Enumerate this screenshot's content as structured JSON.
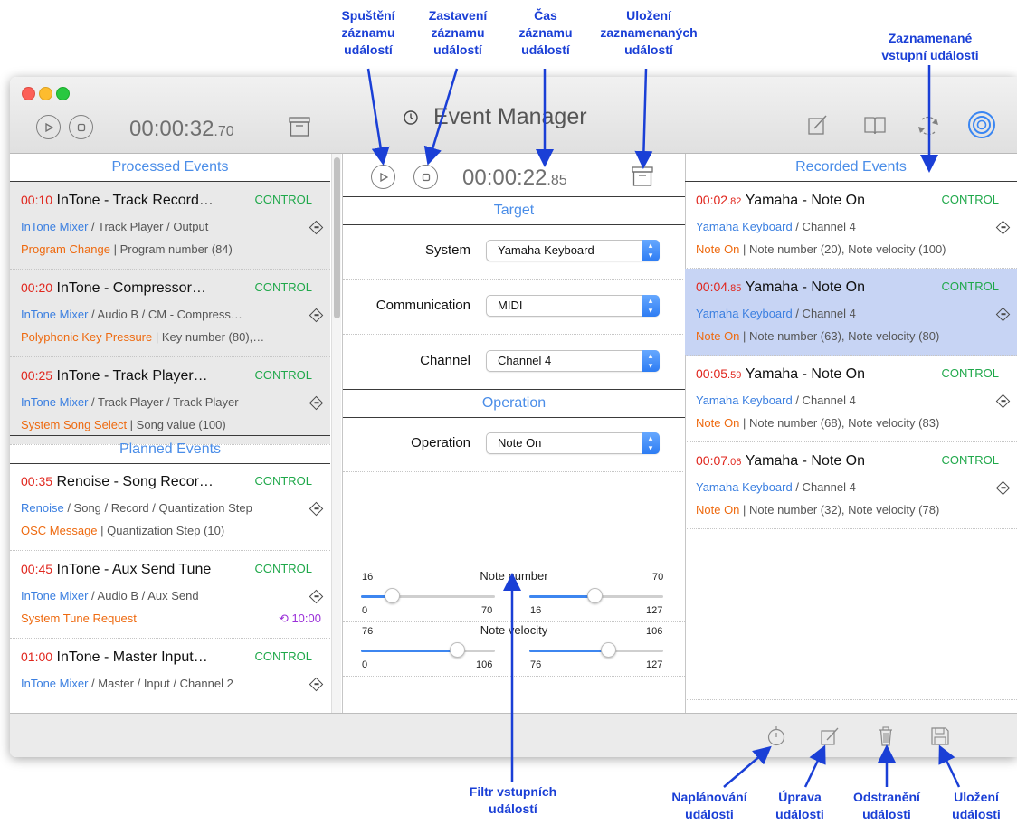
{
  "annotations": {
    "start_recording": "Spuštění\nzáznamu\nudálostí",
    "stop_recording": "Zastavení\nzáznamu\nudálostí",
    "recording_time": "Čas\nzáznamu\nudálostí",
    "save_recorded": "Uložení\nzaznamenaných\nudálostí",
    "recorded_input_events": "Zaznamenané\nvstupní události",
    "input_filter": "Filtr vstupních\nudálostí",
    "schedule_event": "Naplánování\nudálosti",
    "edit_event": "Úprava\nudálosti",
    "delete_event": "Odstranění\nudálosti",
    "save_event": "Uložení\nudálosti"
  },
  "window": {
    "title": "Event Manager",
    "main_clock": {
      "main": "00:00:32",
      "fraction": ".70"
    }
  },
  "processed": {
    "header": "Processed Events",
    "events": [
      {
        "time": "00:10",
        "title": "InTone - Track Record…",
        "badge": "CONTROL",
        "source": "InTone Mixer",
        "path": " / Track Player / Output",
        "type": "Program Change",
        "detail": " | Program number (84)"
      },
      {
        "time": "00:20",
        "title": "InTone - Compressor…",
        "badge": "CONTROL",
        "source": "InTone Mixer",
        "path": " / Audio B / CM - Compress…",
        "type": "Polyphonic Key Pressure",
        "detail": " | Key number (80),…"
      },
      {
        "time": "00:25",
        "title": "InTone - Track Player…",
        "badge": "CONTROL",
        "source": "InTone Mixer",
        "path": " / Track Player / Track Player",
        "type": "System Song Select",
        "detail": " | Song value (100)"
      }
    ]
  },
  "planned": {
    "header": "Planned Events",
    "events": [
      {
        "time": "00:35",
        "title": "Renoise - Song Recor…",
        "badge": "CONTROL",
        "source": "Renoise",
        "path": " / Song / Record / Quantization Step",
        "type": "OSC Message",
        "detail": " | Quantization Step (10)",
        "repeat": ""
      },
      {
        "time": "00:45",
        "title": "InTone - Aux Send Tune",
        "badge": "CONTROL",
        "source": "InTone Mixer",
        "path": " / Audio B / Aux Send",
        "type": "System Tune Request",
        "detail": "",
        "repeat": "10:00"
      },
      {
        "time": "01:00",
        "title": "InTone - Master Input…",
        "badge": "CONTROL",
        "source": "InTone Mixer",
        "path": " / Master / Input / Channel 2",
        "type": "",
        "detail": "",
        "repeat": ""
      }
    ]
  },
  "recorder": {
    "clock": {
      "main": "00:00:22",
      "fraction": ".85"
    },
    "target_header": "Target",
    "system_label": "System",
    "system_value": "Yamaha Keyboard",
    "communication_label": "Communication",
    "communication_value": "MIDI",
    "channel_label": "Channel",
    "channel_value": "Channel 4",
    "operation_header": "Operation",
    "operation_label": "Operation",
    "operation_value": "Note On",
    "note_number": {
      "label": "Note number",
      "left": {
        "top": "16",
        "min": "0",
        "max": "70",
        "value": 16
      },
      "right": {
        "top": "70",
        "min": "16",
        "max": "127",
        "value": 70
      }
    },
    "note_velocity": {
      "label": "Note velocity",
      "left": {
        "top": "76",
        "min": "0",
        "max": "106",
        "value": 76
      },
      "right": {
        "top": "106",
        "min": "76",
        "max": "127",
        "value": 106
      }
    }
  },
  "recorded": {
    "header": "Recorded Events",
    "events": [
      {
        "time": "00:02",
        "frac": ".82",
        "title": "Yamaha - Note On",
        "badge": "CONTROL",
        "source": "Yamaha Keyboard",
        "path": " / Channel 4",
        "type": "Note On",
        "detail": " | Note number (20), Note velocity (100)",
        "selected": false
      },
      {
        "time": "00:04",
        "frac": ".85",
        "title": "Yamaha - Note On",
        "badge": "CONTROL",
        "source": "Yamaha Keyboard",
        "path": " / Channel 4",
        "type": "Note On",
        "detail": " | Note number (63), Note velocity (80)",
        "selected": true
      },
      {
        "time": "00:05",
        "frac": ".59",
        "title": "Yamaha - Note On",
        "badge": "CONTROL",
        "source": "Yamaha Keyboard",
        "path": " / Channel 4",
        "type": "Note On",
        "detail": " | Note number (68), Note velocity (83)",
        "selected": false
      },
      {
        "time": "00:07",
        "frac": ".06",
        "title": "Yamaha - Note On",
        "badge": "CONTROL",
        "source": "Yamaha Keyboard",
        "path": " / Channel 4",
        "type": "Note On",
        "detail": " | Note number (32), Note velocity (78)",
        "selected": false
      }
    ]
  },
  "colors": {
    "accent": "#4a8de8",
    "time_red": "#e0261d",
    "control_green": "#1fa84a",
    "type_orange": "#ee6a10",
    "selection": "#c7d4f4",
    "annotation": "#1a3fd6"
  }
}
